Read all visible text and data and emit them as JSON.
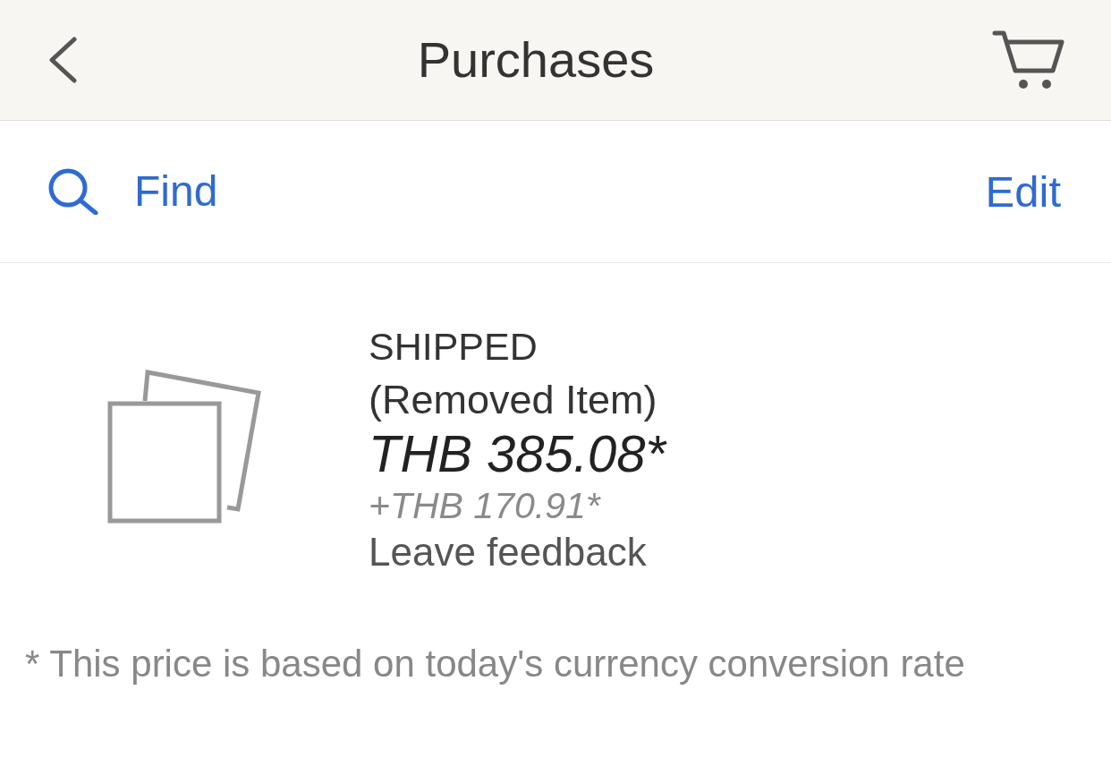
{
  "header": {
    "title": "Purchases"
  },
  "toolbar": {
    "find": "Find",
    "edit": "Edit"
  },
  "orders": [
    {
      "status": "SHIPPED",
      "item": "(Removed Item)",
      "price": "THB 385.08*",
      "extra_price": "+THB 170.91*",
      "action": "Leave feedback"
    }
  ],
  "footnote": "* This price is based on today's currency conversion rate"
}
